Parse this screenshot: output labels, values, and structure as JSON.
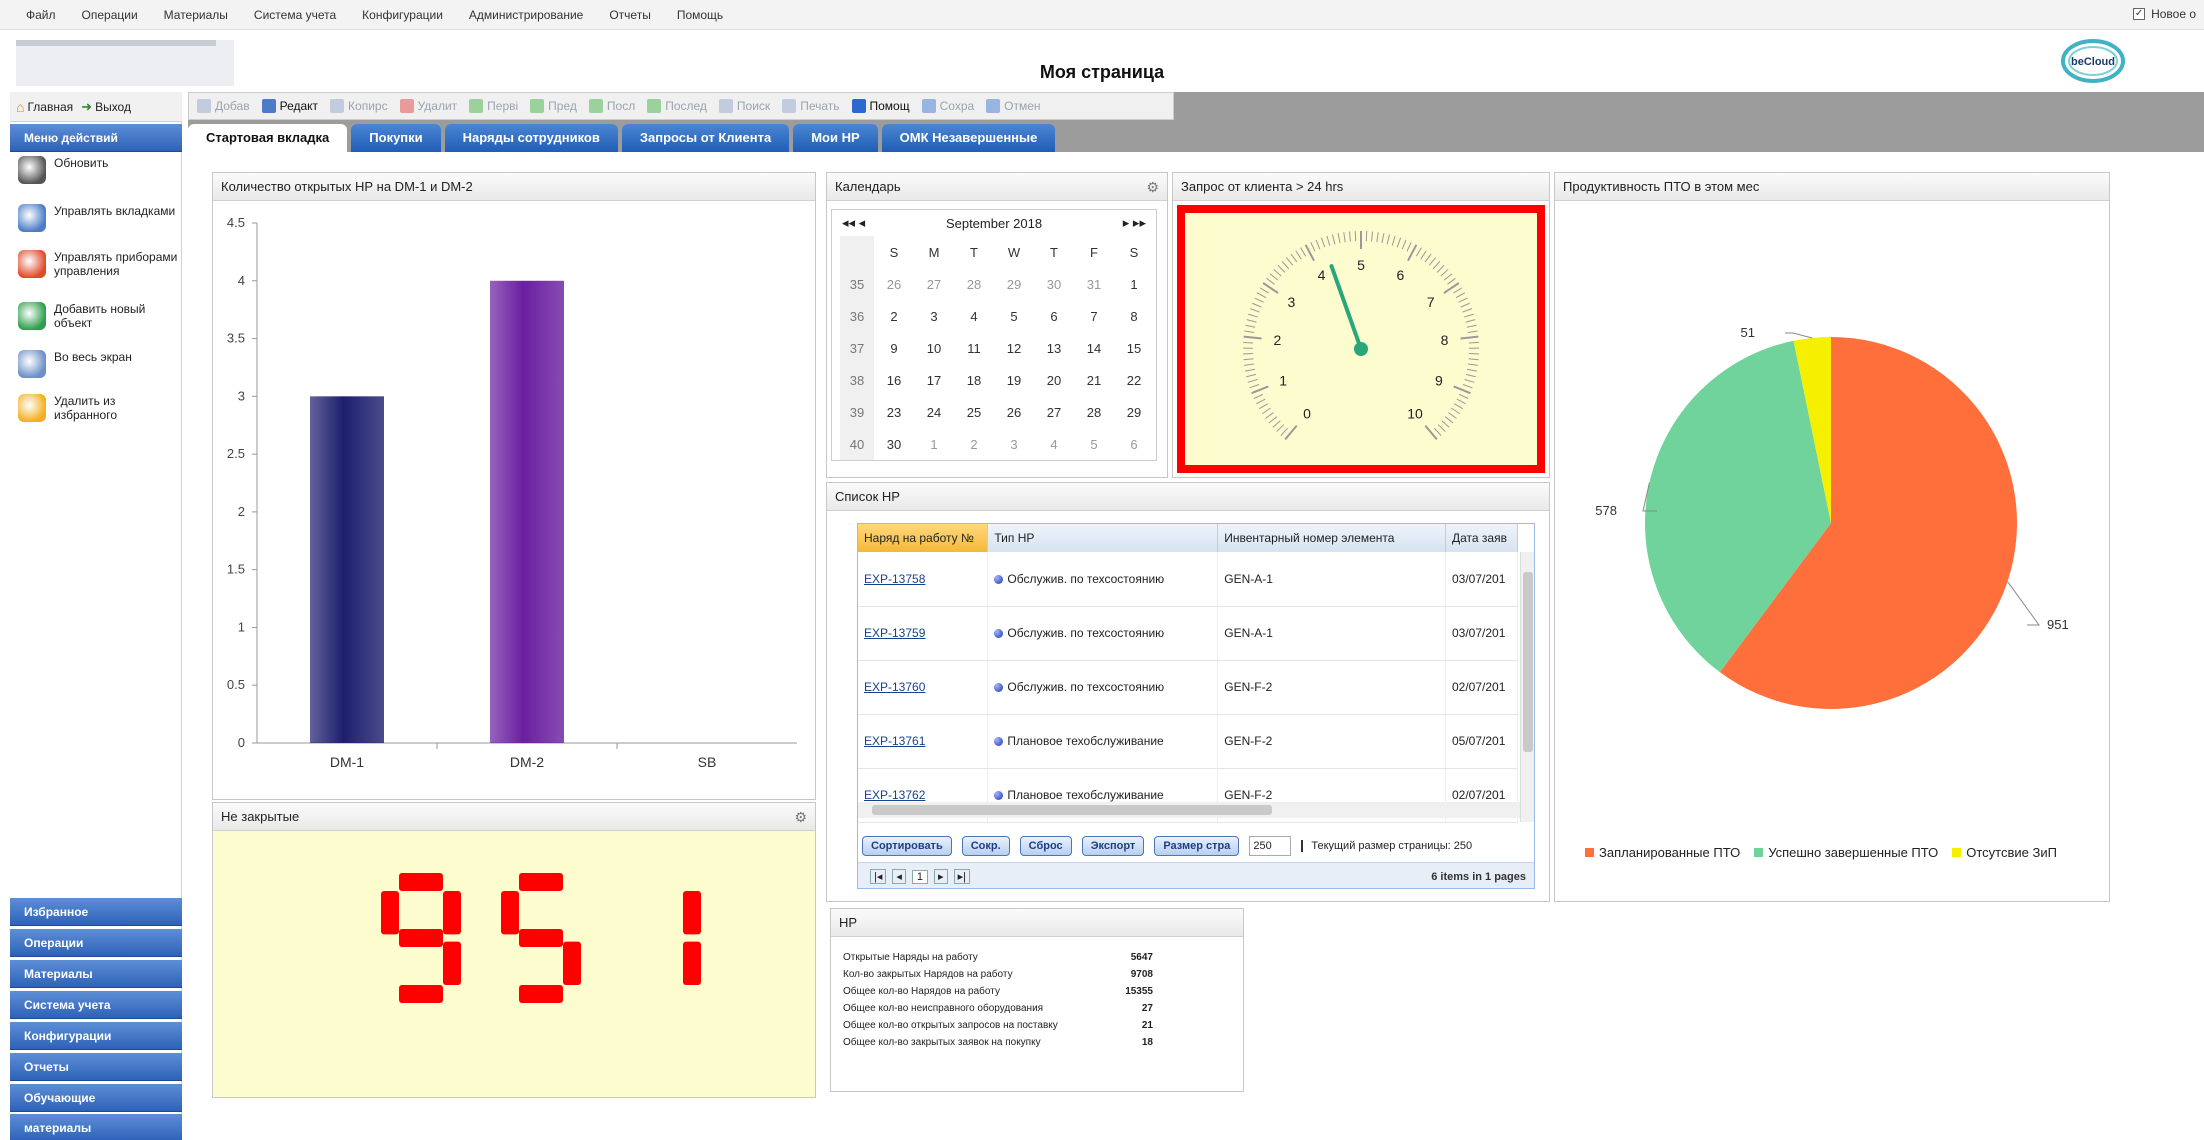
{
  "menu": [
    "Файл",
    "Операции",
    "Материалы",
    "Система учета",
    "Конфигурации",
    "Администрирование",
    "Отчеты",
    "Помощь"
  ],
  "new_window_label": "Новое о",
  "page_title": "Моя страница",
  "logo_right_text": "beCloud",
  "sidebar": {
    "home_label": "Главная",
    "exit_label": "Выход",
    "actions_header": "Меню действий",
    "actions": [
      {
        "label": "Обновить",
        "icon": "refresh-icon"
      },
      {
        "label": "Управлять вкладками",
        "icon": "tabs-manage-icon"
      },
      {
        "label": "Управлять приборами управления",
        "icon": "dashboard-manage-icon"
      },
      {
        "label": "Добавить новый объект",
        "icon": "add-object-icon"
      },
      {
        "label": "Во весь экран",
        "icon": "fullscreen-icon"
      },
      {
        "label": "Удалить из избранного",
        "icon": "remove-favorite-icon"
      }
    ],
    "sections": [
      "Избранное",
      "Операции",
      "Материалы",
      "Система учета",
      "Конфигурации",
      "Отчеты",
      "Обучающие",
      "материалы"
    ]
  },
  "toolbar": [
    "Добав",
    "Редакт",
    "Копирс",
    "Удалит",
    "Перві",
    "Пред",
    "Посл",
    "Послед",
    "Поиск",
    "Печать",
    "Помощ",
    "Сохра",
    "Отмен"
  ],
  "toolbar_enabled": [
    false,
    true,
    false,
    false,
    false,
    false,
    false,
    false,
    false,
    false,
    true,
    false,
    false
  ],
  "tabs": [
    "Стартовая вкладка",
    "Покупки",
    "Наряды сотрудников",
    "Запросы от Клиента",
    "Мои НР",
    "ОМК Незавершенные"
  ],
  "bar_panel": {
    "title": "Количество открытых НР на DM-1 и DM-2"
  },
  "chart_data": {
    "type": "bar",
    "categories": [
      "DM-1",
      "DM-2",
      "SB"
    ],
    "values": [
      3,
      4,
      0
    ],
    "ylim": [
      0,
      4.5
    ],
    "yticks": [
      "0",
      "0.5",
      "1",
      "1.5",
      "2",
      "2.5",
      "3",
      "3.5",
      "4",
      "4.5"
    ],
    "colors": [
      "#1d1f6e",
      "#6a1fa0",
      "#cccccc"
    ]
  },
  "open_panel": {
    "title": "Не закрытые",
    "value": "951"
  },
  "calendar": {
    "title": "Календарь",
    "month": "September 2018",
    "days": [
      "S",
      "M",
      "T",
      "W",
      "T",
      "F",
      "S"
    ],
    "weeks": [
      {
        "wk": "35",
        "d": [
          "26",
          "27",
          "28",
          "29",
          "30",
          "31",
          "1"
        ]
      },
      {
        "wk": "36",
        "d": [
          "2",
          "3",
          "4",
          "5",
          "6",
          "7",
          "8"
        ]
      },
      {
        "wk": "37",
        "d": [
          "9",
          "10",
          "11",
          "12",
          "13",
          "14",
          "15"
        ]
      },
      {
        "wk": "38",
        "d": [
          "16",
          "17",
          "18",
          "19",
          "20",
          "21",
          "22"
        ]
      },
      {
        "wk": "39",
        "d": [
          "23",
          "24",
          "25",
          "26",
          "27",
          "28",
          "29"
        ]
      },
      {
        "wk": "40",
        "d": [
          "30",
          "1",
          "2",
          "3",
          "4",
          "5",
          "6"
        ]
      }
    ]
  },
  "gauge": {
    "title": "Запрос от клиента > 24 hrs",
    "labels": [
      "0",
      "1",
      "2",
      "3",
      "4",
      "5",
      "6",
      "7",
      "8",
      "9",
      "10"
    ],
    "value": 4.3
  },
  "grid": {
    "title": "Список НР",
    "columns": [
      "Наряд на работу №",
      "Тип НР",
      "Инвентарный номер элемента",
      "Дата заяв"
    ],
    "rows": [
      [
        "EXP-13758",
        "Обслужив. по техсостоянию",
        "GEN-A-1",
        "03/07/201"
      ],
      [
        "EXP-13759",
        "Обслужив. по техсостоянию",
        "GEN-A-1",
        "03/07/201"
      ],
      [
        "EXP-13760",
        "Обслужив. по техсостоянию",
        "GEN-F-2",
        "02/07/201"
      ],
      [
        "EXP-13761",
        "Плановое техобслуживание",
        "GEN-F-2",
        "05/07/201"
      ],
      [
        "EXP-13762",
        "Плановое техобслуживание",
        "GEN-F-2",
        "02/07/201"
      ]
    ],
    "buttons": [
      "Сортировать",
      "Сокр.",
      "Сброс",
      "Экспорт",
      "Размер стра"
    ],
    "page_size": "250",
    "page_size_label": "Текущий размер страницы: 250",
    "page_num": "1",
    "items_info": "6 items in 1 pages"
  },
  "stats": {
    "title": "НР",
    "rows": [
      [
        "Открытые Наряды на работу",
        "5647"
      ],
      [
        "Кол-во закрытых Нарядов на работу",
        "9708"
      ],
      [
        "Общее кол-во Нарядов на работу",
        "15355"
      ],
      [
        "Общее кол-во неисправного оборудования",
        "27"
      ],
      [
        "Общее кол-во открытых запросов на поставку",
        "21"
      ],
      [
        "Общее кол-во закрытых заявок на покупку",
        "18"
      ]
    ]
  },
  "pie": {
    "title": "Продуктивность ПТО в этом мес",
    "slices": [
      {
        "label": "Запланированные ПТО",
        "value": 951,
        "color": "#ff6f3c"
      },
      {
        "label": "Успешно завершенные ПТО",
        "value": 578,
        "color": "#6fd39b"
      },
      {
        "label": "Отсутсвие ЗиП",
        "value": 51,
        "color": "#f4f000"
      }
    ],
    "value_labels": [
      "951",
      "578",
      "51"
    ]
  }
}
